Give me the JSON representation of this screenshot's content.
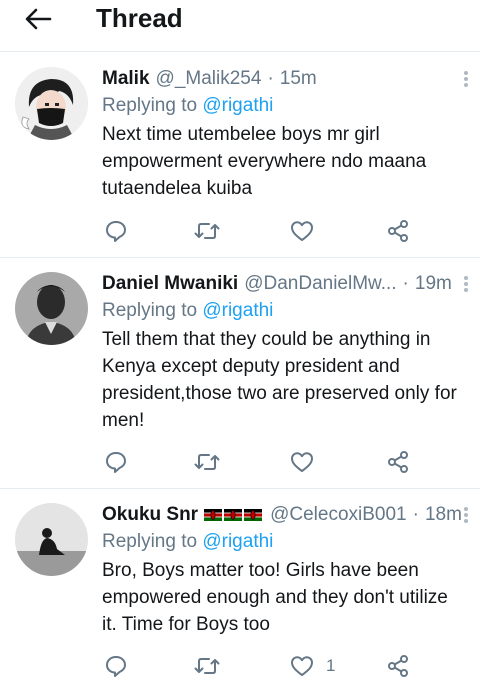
{
  "header": {
    "title": "Thread"
  },
  "tweets": [
    {
      "name": "Malik",
      "handle": "@_Malik254",
      "separator": "·",
      "time": "15m",
      "replying_prefix": "Replying to",
      "replying_to": "@rigathi",
      "text": "Next time utembelee boys mr girl empowerment everywhere ndo maana tutaendelea kuiba",
      "like_count": ""
    },
    {
      "name": "Daniel Mwaniki",
      "handle": "@DanDanielMw...",
      "separator": "·",
      "time": "19m",
      "replying_prefix": "Replying to",
      "replying_to": "@rigathi",
      "text": "Tell them that they could be anything in Kenya except deputy president and president,those two are preserved only for men!",
      "like_count": ""
    },
    {
      "name": "Okuku Snr",
      "handle": "@CelecoxiB001",
      "separator": "·",
      "time": "18m",
      "replying_prefix": "Replying to",
      "replying_to": "@rigathi",
      "text": "Bro, Boys matter too! Girls have been empowered enough and they don't utilize it. Time for Boys too",
      "like_count": "1",
      "name_emoji": "kenya-flag-icon x3"
    }
  ],
  "icons": {
    "back": "arrow-left-icon",
    "more": "more-vertical-icon",
    "reply": "reply-icon",
    "retweet": "retweet-icon",
    "like": "heart-icon",
    "share": "share-icon"
  },
  "colors": {
    "text": "#14171a",
    "secondary": "#657786",
    "accent": "#1da1f2",
    "divider": "#e6ecf0"
  }
}
